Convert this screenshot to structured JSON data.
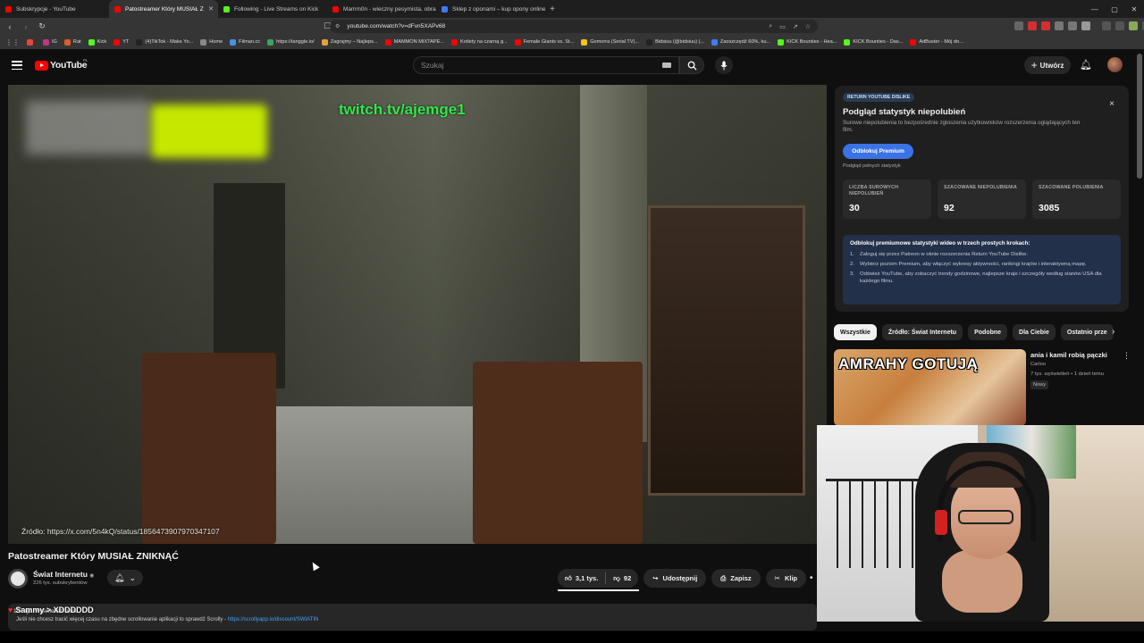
{
  "browser": {
    "tabs": [
      {
        "title": "Subskrypcje - YouTube",
        "color": "#ff0000",
        "active": false
      },
      {
        "title": "Patostreamer Który MUSIAŁ Z",
        "color": "#ff0000",
        "active": true
      },
      {
        "title": "Following - Live Streams on Kick",
        "color": "#53fc18",
        "active": false
      },
      {
        "title": "Mamm0n - wieczny pesymista, obrażo",
        "color": "#ff0000",
        "active": false
      },
      {
        "title": "Sklep z oponami – kup opony online",
        "color": "#3e7bfa",
        "active": false
      }
    ],
    "url": "youtube.com/watch?v=dFvn5XAPv68",
    "bookmarks": [
      {
        "label": "",
        "color": "#e8453c"
      },
      {
        "label": "IG",
        "color": "#c13584"
      },
      {
        "label": "Rat",
        "color": "#e05a2a"
      },
      {
        "label": "Kick",
        "color": "#53fc18"
      },
      {
        "label": "YT",
        "color": "#ff0000"
      },
      {
        "label": "(4)TikTok - Make Yo...",
        "color": "#222222"
      },
      {
        "label": "Home",
        "color": "#888888"
      },
      {
        "label": "Filman.cc",
        "color": "#4a90e2"
      },
      {
        "label": "https://tanggle.io/",
        "color": "#3aa55d"
      },
      {
        "label": "Zagrajmy – Najleps...",
        "color": "#e2a23a"
      },
      {
        "label": "MAMMON MIXTAPE...",
        "color": "#ff0000"
      },
      {
        "label": "Kotlety na czarną g...",
        "color": "#ff0000"
      },
      {
        "label": "Female Giants vs. St...",
        "color": "#ff0000"
      },
      {
        "label": "Gomorra (Serial TV)...",
        "color": "#f5c518"
      },
      {
        "label": "Bidsiuu (@bidsiuu) |...",
        "color": "#222222"
      },
      {
        "label": "Zaoszczędź 60%, ku...",
        "color": "#3e7bfa"
      },
      {
        "label": "KICK Bounties - Hea...",
        "color": "#53fc18"
      },
      {
        "label": "KICK Bounties - Das...",
        "color": "#53fc18"
      },
      {
        "label": "AdBuster - Mój do...",
        "color": "#ff0000"
      }
    ]
  },
  "youtube": {
    "logo_text": "YouTube",
    "logo_region": "PL",
    "search_placeholder": "Szukaj",
    "create_label": "Utwórz"
  },
  "video": {
    "overlay_text": "twitch.tv/ajemge1",
    "source_text": "Źródło: https://x.com/5n4kQ/status/1856473907970347107",
    "title": "Patostreamer Który MUSIAŁ ZNIKNĄĆ",
    "channel_name": "Świat Internetu",
    "subscribers": "226 tys. subskrybentów",
    "likes": "3,1 tys.",
    "dislikes": "92",
    "like_ratio": 0.97,
    "share_label": "Udostępnij",
    "save_label": "Zapisz",
    "clip_label": "Klip",
    "desc_line1": "157 tys. wyświetleń  temu",
    "desc_line2": "Jeśli nie chcesz tracić więcej czasu na zbędne scrollowanie aplikacji to sprawdź Scrolly -",
    "desc_link": "https://scrollyapp.io/discount/SWIATIN",
    "chat_message": "Sammy > XDDDDDD"
  },
  "ryd": {
    "badge": "RETURN YOUTUBE DISLIKE",
    "title": "Podgląd statystyk niepolubień",
    "description": "Surowe niepolubienia to bezpośrednie zgłoszenia użytkowników rozszerzenia oglądających ten film.",
    "button": "Odblokuj Premium",
    "sub": "Podgląd pełnych statystyk",
    "stats": [
      {
        "label": "LICZBA SUROWYCH NIEPOLUBIEŃ",
        "value": "30"
      },
      {
        "label": "SZACOWANE NIEPOLUBIENIA",
        "value": "92"
      },
      {
        "label": "SZACOWANE POLUBIENIA",
        "value": "3085"
      }
    ],
    "steps_title": "Odblokuj premiumowe statystyki wideo w trzech prostych krokach:",
    "steps": [
      {
        "n": "1.",
        "text": "Zaloguj się przez Patreon w oknie rozszerzenia Return YouTube Dislike."
      },
      {
        "n": "2.",
        "text": "Wybierz poziom Premium, aby włączyć wykresy aktywności, rankingi krajów i interaktywną mapę."
      },
      {
        "n": "3.",
        "text": "Odśwież YouTube, aby zobaczyć trendy godzinowe, najlepsze kraje i szczegóły według stanów USA dla każdego filmu."
      }
    ]
  },
  "chips": [
    "Wszystkie",
    "Źródło: Świat Internetu",
    "Podobne",
    "Dla Ciebie",
    "Ostatnio prze"
  ],
  "recommended": {
    "thumb_text": "AMRAHY GOTUJĄ",
    "title": "ania i kamil robią pączki",
    "channel": "Carloo",
    "meta": "7 tys. wyświetleń • 1 dzień temu",
    "badge": "Nowy"
  }
}
